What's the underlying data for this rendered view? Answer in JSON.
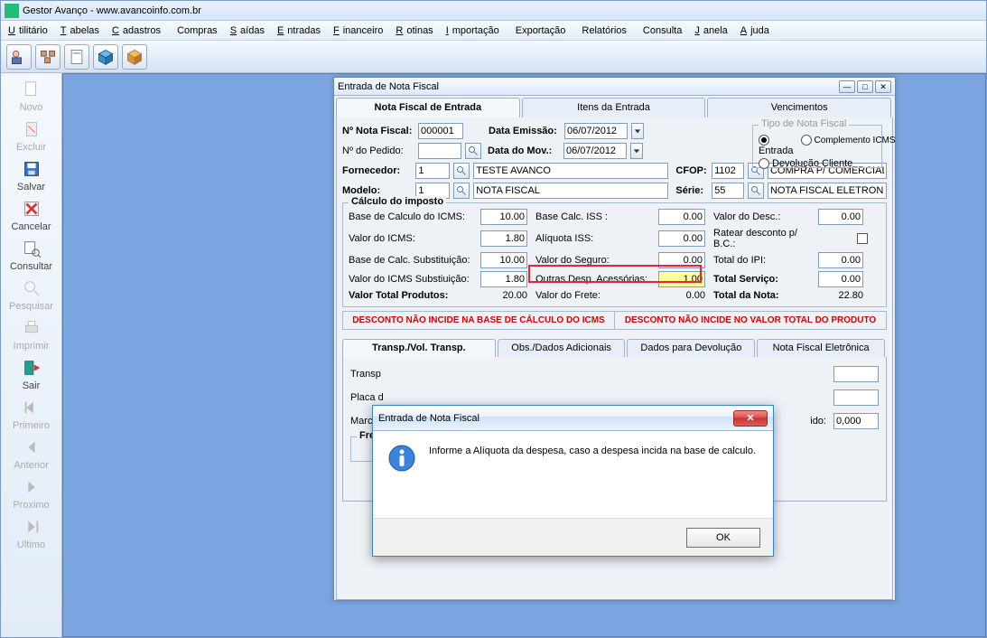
{
  "app_title": "Gestor Avanço - www.avancoinfo.com.br",
  "menu": [
    "Utilitário",
    "Tabelas",
    "Cadastros",
    "Compras",
    "Saídas",
    "Entradas",
    "Financeiro",
    "Rotinas",
    "Importação",
    "Exportação",
    "Relatórios",
    "Consulta",
    "Janela",
    "Ajuda"
  ],
  "left_toolbar": {
    "novo": "Novo",
    "excluir": "Excluir",
    "salvar": "Salvar",
    "cancelar": "Cancelar",
    "consultar": "Consultar",
    "pesquisar": "Pesquisar",
    "imprimir": "Imprimir",
    "sair": "Sair",
    "primeiro": "Primeiro",
    "anterior": "Anterior",
    "proximo": "Proximo",
    "ultimo": "Ultimo"
  },
  "form": {
    "title": "Entrada de Nota Fiscal",
    "tabs": [
      "Nota Fiscal de Entrada",
      "Itens da Entrada",
      "Vencimentos"
    ],
    "header": {
      "nota_fiscal_label": "Nº Nota Fiscal:",
      "nota_fiscal_value": "000001",
      "pedido_label": "Nº do Pedido:",
      "emissao_label": "Data Emissão:",
      "emissao_value": "06/07/2012",
      "mov_label": "Data do Mov.:",
      "mov_value": "06/07/2012",
      "fornecedor_label": "Fornecedor:",
      "fornecedor_cod": "1",
      "fornecedor_nome": "TESTE AVANCO",
      "modelo_label": "Modelo:",
      "modelo_cod": "1",
      "modelo_nome": "NOTA FISCAL",
      "cfop_label": "CFOP:",
      "cfop_cod": "1102",
      "cfop_nome": "COMPRA P/ COMERCIALIZACAO",
      "serie_label": "Série:",
      "serie_cod": "55",
      "serie_nome": "NOTA FISCAL ELETRONICA",
      "tipo_nf_group": "Tipo de Nota Fiscal",
      "tipo_entrada": "Entrada",
      "tipo_compl": "Complemento ICMS",
      "tipo_devol": "Devolução Cliente"
    },
    "calc": {
      "group_title": "Cálculo do imposto",
      "base_icms_l": "Base de Calculo do ICMS:",
      "base_icms_v": "10.00",
      "valor_icms_l": "Valor do ICMS:",
      "valor_icms_v": "1.80",
      "base_sub_l": "Base de Calc. Substituição:",
      "base_sub_v": "10.00",
      "valor_sub_l": "Valor do ICMS Substiuição:",
      "valor_sub_v": "1.80",
      "total_prod_l": "Valor Total Produtos:",
      "total_prod_v": "20.00",
      "base_iss_l": "Base Calc. ISS :",
      "base_iss_v": "0.00",
      "aliq_iss_l": "Alíquota ISS:",
      "aliq_iss_v": "0.00",
      "seguro_l": "Valor do Seguro:",
      "seguro_v": "0.00",
      "outras_l": "Outras Desp. Acessórias:",
      "outras_v": "1.00",
      "frete_l": "Valor do Frete:",
      "frete_v": "0.00",
      "desc_l": "Valor do Desc.:",
      "desc_v": "0.00",
      "ratear_l": "Ratear desconto p/ B.C.:",
      "ipi_l": "Total do IPI:",
      "ipi_v": "0.00",
      "serv_l": "Total Serviço:",
      "serv_v": "0.00",
      "total_nota_l": "Total da Nota:",
      "total_nota_v": "22.80"
    },
    "banners": {
      "b1": "DESCONTO NÃO INCIDE NA BASE DE CÁLCULO DO ICMS",
      "b2": "DESCONTO NÃO INCIDE NO VALOR TOTAL DO PRODUTO"
    },
    "subtabs": [
      "Transp./Vol. Transp.",
      "Obs./Dados Adicionais",
      "Dados para Devolução",
      "Nota Fiscal Eletrônica"
    ],
    "transp": {
      "transp_l": "Transp",
      "placa_l": "Placa d",
      "marca_l": "Marca",
      "liquido_l": "ido:",
      "liquido_v": "0,000",
      "frete_group": "Frete"
    }
  },
  "modal": {
    "title": "Entrada de Nota Fiscal",
    "text": "Informe a Alíquota da despesa, caso a despesa incida na base de calculo.",
    "ok": "OK"
  }
}
